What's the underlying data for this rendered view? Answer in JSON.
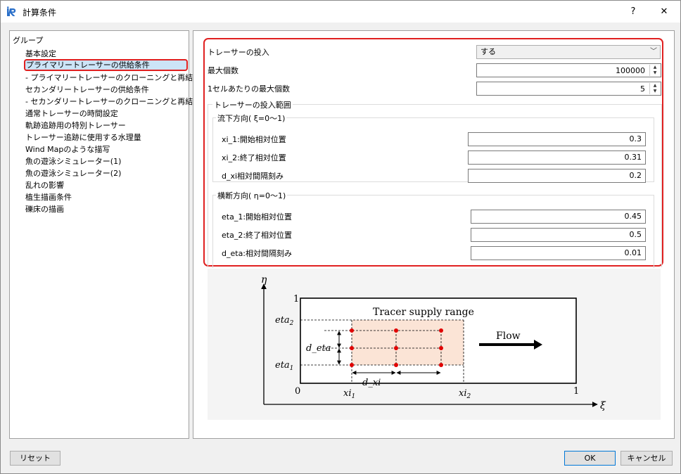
{
  "window": {
    "title": "計算条件",
    "help_label": "?",
    "close_label": "✕"
  },
  "tree": {
    "header": "グループ",
    "items": [
      {
        "label": "基本設定"
      },
      {
        "label": "プライマリートレーサーの供給条件",
        "selected": true
      },
      {
        "label": "- プライマリートレーサーのクローニングと再結合"
      },
      {
        "label": "セカンダリートレーサーの供給条件"
      },
      {
        "label": "- セカンダリートレーサーのクローニングと再結合"
      },
      {
        "label": "通常トレーサーの時間設定"
      },
      {
        "label": "軌跡追跡用の特別トレーサー"
      },
      {
        "label": "トレーサー追跡に使用する水理量"
      },
      {
        "label": "Wind Mapのような描写"
      },
      {
        "label": "魚の遊泳シミュレーター(1)"
      },
      {
        "label": "魚の遊泳シミュレーター(2)"
      },
      {
        "label": "乱れの影響"
      },
      {
        "label": "植生描画条件"
      },
      {
        "label": "礫床の描画"
      }
    ]
  },
  "form": {
    "tracer_input": {
      "label": "トレーサーの投入",
      "value": "する"
    },
    "max_count": {
      "label": "最大個数",
      "value": "100000"
    },
    "max_per_cell": {
      "label": "1セルあたりの最大個数",
      "value": "5"
    },
    "range_group": "トレーサーの投入範囲",
    "stream": {
      "title": "流下方向( ξ=0〜1)",
      "xi1": {
        "label": "xi_1:開始相対位置",
        "value": "0.3"
      },
      "xi2": {
        "label": "xi_2:終了相対位置",
        "value": "0.31"
      },
      "dxi": {
        "label": "d_xi相対間隔刻み",
        "value": "0.2"
      }
    },
    "cross": {
      "title": "横断方向( η=0〜1)",
      "eta1": {
        "label": "eta_1:開始相対位置",
        "value": "0.45"
      },
      "eta2": {
        "label": "eta_2:終了相対位置",
        "value": "0.5"
      },
      "deta": {
        "label": "d_eta:相対間隔刻み",
        "value": "0.01"
      }
    }
  },
  "diagram": {
    "eta_axis": "η",
    "xi_axis": "ξ",
    "box_title": "Tracer supply range",
    "flow_label": "Flow",
    "one_top": "1",
    "origin": "0",
    "one_right": "1",
    "eta2": "eta",
    "eta2_sub": "2",
    "eta1": "eta",
    "eta1_sub": "1",
    "d_eta": "d_eta",
    "d_xi": "d_xi",
    "xi1": "xi",
    "xi1_sub": "1",
    "xi2": "xi",
    "xi2_sub": "2"
  },
  "buttons": {
    "reset": "リセット",
    "ok": "OK",
    "cancel": "キャンセル"
  },
  "colors": {
    "highlight": "#e02020",
    "selection": "#cce4f7",
    "supply_fill": "#fbe4d6",
    "dot": "#e00000",
    "accent": "#0078d7"
  }
}
